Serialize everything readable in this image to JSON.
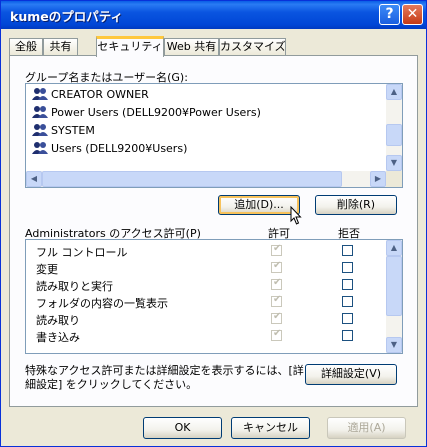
{
  "window": {
    "title": "kumeのプロパティ",
    "help_label": "?",
    "close_label": "✕"
  },
  "tabs": [
    {
      "label": "全般",
      "active": false
    },
    {
      "label": "共有",
      "active": false
    },
    {
      "label": "セキュリティ",
      "active": true
    },
    {
      "label": "Web 共有",
      "active": false
    },
    {
      "label": "カスタマイズ",
      "active": false
    }
  ],
  "groups": {
    "label": "グループ名またはユーザー名(G):",
    "items": [
      {
        "name": "CREATOR OWNER",
        "icon": "user-group-icon"
      },
      {
        "name": "Power Users (DELL9200¥Power Users)",
        "icon": "user-group-icon"
      },
      {
        "name": "SYSTEM",
        "icon": "user-group-icon"
      },
      {
        "name": "Users (DELL9200¥Users)",
        "icon": "user-group-icon"
      }
    ]
  },
  "buttons": {
    "add": "追加(D)...",
    "remove": "削除(R)",
    "advanced": "詳細設定(V)",
    "ok": "OK",
    "cancel": "キャンセル",
    "apply": "適用(A)"
  },
  "permissions": {
    "label": "Administrators のアクセス許可(P)",
    "allow_header": "許可",
    "deny_header": "拒否",
    "rows": [
      {
        "name": "フル コントロール",
        "allow": true,
        "deny": false
      },
      {
        "name": "変更",
        "allow": true,
        "deny": false
      },
      {
        "name": "読み取りと実行",
        "allow": true,
        "deny": false
      },
      {
        "name": "フォルダの内容の一覧表示",
        "allow": true,
        "deny": false
      },
      {
        "name": "読み取り",
        "allow": true,
        "deny": false
      },
      {
        "name": "書き込み",
        "allow": true,
        "deny": false
      }
    ]
  },
  "note": {
    "line1": "特殊なアクセス許可または詳細設定を表示するには、[詳",
    "line2": "細設定] をクリックしてください。"
  }
}
